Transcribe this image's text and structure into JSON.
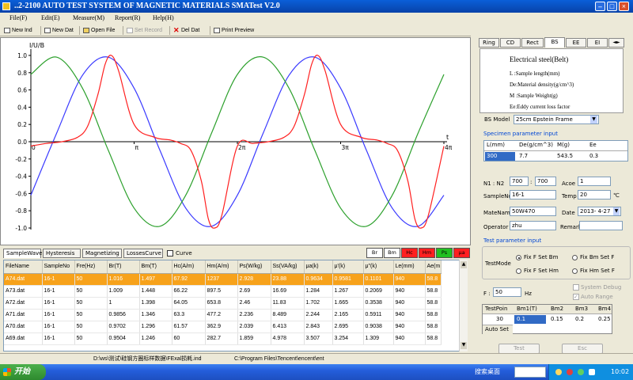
{
  "window": {
    "title": "..2-2100 AUTO TEST SYSTEM OF MAGNETIC MATERIALS   SMATest V2.0"
  },
  "menu": [
    "File(F)",
    "Edit(E)",
    "Measure(M)",
    "Report(R)",
    "Help(H)"
  ],
  "toolbar": {
    "new_ind": "New Ind",
    "new_dat": "New Dat",
    "open_file": "Open File",
    "set_record": "Set Record",
    "del_dat": "Del Dat",
    "print_preview": "Print Preview"
  },
  "chart_data": {
    "type": "line",
    "ylabel": "I/U/B",
    "xlabel": "t",
    "ylim": [
      -1.0,
      1.0
    ],
    "xlim": [
      0,
      4
    ],
    "yticks": [
      "1.0",
      "0.8",
      "0.6",
      "0.4",
      "0.2",
      "0.0",
      "-0.2",
      "-0.4",
      "-0.6",
      "-0.8",
      "-1.0"
    ],
    "xticks": [
      "0",
      "π",
      "2π",
      "3π",
      "4π"
    ],
    "series": [
      {
        "color": "#3a3aff",
        "x": [
          0,
          0.25,
          0.5,
          0.75,
          1,
          1.25,
          1.5,
          1.75,
          2,
          2.25,
          2.5,
          2.75,
          3,
          3.25,
          3.5,
          3.75,
          4
        ],
        "y": [
          -0.62,
          0.1,
          0.77,
          0.98,
          0.62,
          -0.1,
          -0.77,
          -0.98,
          -0.62,
          0.1,
          0.77,
          0.98,
          0.62,
          -0.1,
          -0.77,
          -0.98,
          -0.62
        ]
      },
      {
        "color": "#2ca02c",
        "x": [
          0,
          0.25,
          0.5,
          0.75,
          1,
          1.25,
          1.5,
          1.75,
          2,
          2.25,
          2.5,
          2.75,
          3,
          3.25,
          3.5,
          3.75,
          4
        ],
        "y": [
          0.78,
          0.98,
          0.62,
          -0.1,
          -0.77,
          -0.98,
          -0.62,
          0.1,
          0.78,
          0.98,
          0.62,
          -0.1,
          -0.77,
          -0.98,
          -0.62,
          0.1,
          0.78
        ]
      },
      {
        "color": "#ff2020",
        "x": [
          0,
          0.15,
          0.3,
          0.45,
          0.55,
          0.65,
          0.72,
          0.78,
          0.85,
          1,
          1.2,
          1.35,
          1.45,
          1.55,
          1.65,
          1.72,
          1.78,
          1.85,
          2,
          2.15,
          2.3,
          2.45,
          2.55,
          2.65,
          2.72,
          2.78,
          2.85,
          3,
          3.2,
          3.35,
          3.45,
          3.55,
          3.65,
          3.72,
          3.78,
          3.85,
          4
        ],
        "y": [
          -0.05,
          -0.02,
          0.0,
          0.05,
          0.18,
          0.55,
          0.9,
          1.0,
          0.82,
          0.2,
          0.05,
          0.02,
          -0.02,
          -0.1,
          -0.45,
          -0.9,
          -1.0,
          -0.85,
          -0.05,
          -0.02,
          0.0,
          0.05,
          0.18,
          0.55,
          0.9,
          1.0,
          0.82,
          0.2,
          0.05,
          0.02,
          -0.02,
          -0.1,
          -0.45,
          -0.9,
          -1.0,
          -0.85,
          -0.05
        ]
      }
    ]
  },
  "bottom_tabs": [
    "SampleWave",
    "Hysteresis",
    "Magnetizing",
    "LossesCurve"
  ],
  "curve_label": "Curve",
  "color_buttons": [
    {
      "label": "Br",
      "bg": "#ffffff",
      "fg": "#000000"
    },
    {
      "label": "Bm",
      "bg": "#ffffff",
      "fg": "#000000"
    },
    {
      "label": "Hc",
      "bg": "#ff2020",
      "fg": "#000000"
    },
    {
      "label": "Hm",
      "bg": "#ff2020",
      "fg": "#000000"
    },
    {
      "label": "Ps",
      "bg": "#20c020",
      "fg": "#000000"
    },
    {
      "label": "μa",
      "bg": "#ff2020",
      "fg": "#000000"
    }
  ],
  "table": {
    "headers": [
      "FileName",
      "SampleNo",
      "Fre(Hz)",
      "Br(T)",
      "Bm(T)",
      "Hc(A/m)",
      "Hm(A/m)",
      "Ps(W/kg)",
      "Ss(VA/kg)",
      "μa(k)",
      "μ'(k)",
      "μ\"(k)",
      "Le(mm)",
      "Ae(m"
    ],
    "rows": [
      [
        "A74.dat",
        "16-1",
        "50",
        "1.016",
        "1.497",
        "67.92",
        "1237",
        "2.928",
        "23.88",
        "0.9634",
        "0.9581",
        "0.1101",
        "940",
        "58.8"
      ],
      [
        "A73.dat",
        "16-1",
        "50",
        "1.009",
        "1.448",
        "66.22",
        "897.5",
        "2.69",
        "16.69",
        "1.284",
        "1.267",
        "0.2069",
        "940",
        "58.8"
      ],
      [
        "A72.dat",
        "16-1",
        "50",
        "1",
        "1.398",
        "64.05",
        "653.8",
        "2.46",
        "11.83",
        "1.702",
        "1.665",
        "0.3538",
        "940",
        "58.8"
      ],
      [
        "A71.dat",
        "16-1",
        "50",
        "0.9856",
        "1.346",
        "63.3",
        "477.2",
        "2.236",
        "8.489",
        "2.244",
        "2.165",
        "0.5911",
        "940",
        "58.8"
      ],
      [
        "A70.dat",
        "16-1",
        "50",
        "0.9702",
        "1.296",
        "61.57",
        "362.9",
        "2.039",
        "6.413",
        "2.843",
        "2.695",
        "0.9038",
        "940",
        "58.8"
      ],
      [
        "A69.dat",
        "16-1",
        "50",
        "0.9504",
        "1.246",
        "60",
        "282.7",
        "1.859",
        "4.978",
        "3.507",
        "3.254",
        "1.309",
        "940",
        "58.8"
      ]
    ]
  },
  "status": {
    "path1": "D:\\ws\\测试\\硅钢方圈标样数据\\FExal损耗.ind",
    "path2": "C:\\Program Files\\Tencent\\encent\\ent"
  },
  "taskbar": {
    "start": "开始",
    "search": "搜索桌面",
    "time": "10:02"
  },
  "right_panel": {
    "tabs": [
      "Ring",
      "CD",
      "Rect",
      "BS",
      "EE",
      "EI"
    ],
    "selected_tab": "BS",
    "desc_title": "Electrical steel(Belt)",
    "desc_lines": [
      "L :Sample length(mm)",
      "De:Material density(g/cm^3)",
      "M :Sample Weight(g)",
      "Ee:Eddy current loss factor"
    ],
    "bs_model_label": "BS Model",
    "bs_model_value": "25cm Epstein Frame",
    "specimen_header": "Specimen parameter input",
    "spec_cols": [
      "L(mm)",
      "De(g/cm^3)",
      "M(g)",
      "Ee"
    ],
    "spec_vals": [
      "300",
      "7.7",
      "543.5",
      "0.3"
    ],
    "n_label": "N1 : N2",
    "n1": "700",
    "n_sep": ":",
    "n2": "700",
    "acoe_label": "Acoe",
    "acoe": "1",
    "sampleno_label": "SampleNo",
    "sampleno": "16-1",
    "temp_label": "Temp",
    "temp": "20",
    "temp_unit": "℃",
    "matename_label": "MateName",
    "matename": "50W470",
    "date_label": "Date",
    "date": "2013- 4-27",
    "operator_label": "Operator",
    "operator": "zhu",
    "remark_label": "Remark",
    "remark": "",
    "test_header": "Test parameter input",
    "testmode_label": "TestMode",
    "modes": [
      "Fix F Set Bm",
      "Fix Bm Set F",
      "Fix F Set Hm",
      "Fix Hm Set F"
    ],
    "system_debug": "System Debug",
    "auto_range": "Auto Range",
    "f_label": "F :",
    "f_value": "50",
    "f_unit": "Hz",
    "tp_headers": [
      "TestPoin",
      "Bm1(T)",
      "Bm2",
      "Bm3",
      "Bm4"
    ],
    "tp_values": [
      "30",
      "0.1",
      "0.15",
      "0.2",
      "0.25"
    ],
    "auto_set": "Auto Set",
    "test_btn": "Test",
    "esc_btn": "Esc"
  }
}
